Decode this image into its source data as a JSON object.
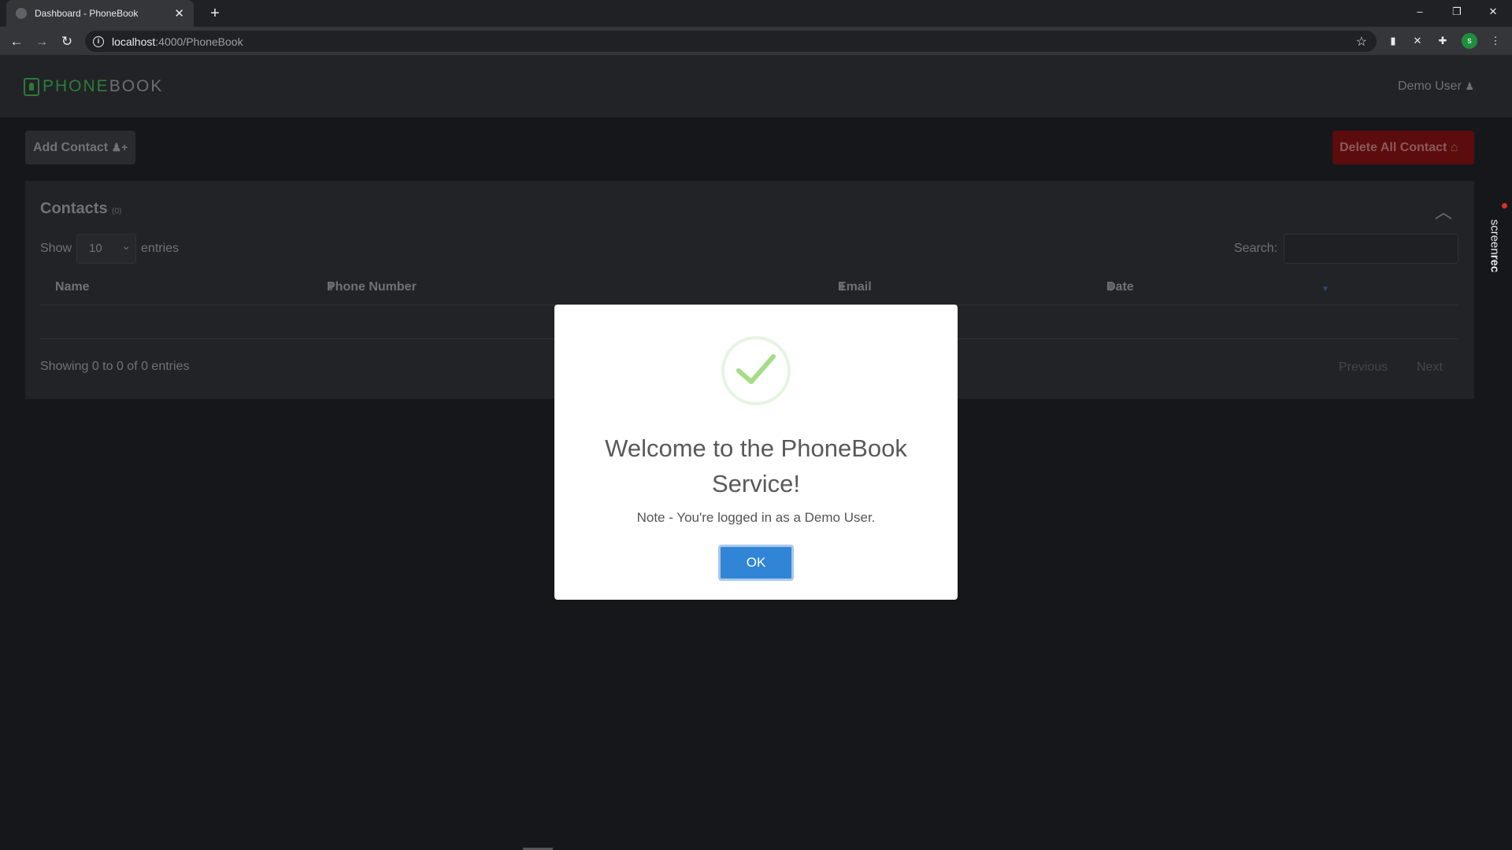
{
  "browser": {
    "tab_title": "Dashboard - PhoneBook",
    "tab_close": "✕",
    "new_tab": "+",
    "url_host": "localhost",
    "url_path": ":4000/PhoneBook",
    "profile_initial": "s",
    "window": {
      "minimize": "–",
      "restore": "❐",
      "close": "✕"
    }
  },
  "app": {
    "logo_part1": "PHONE",
    "logo_part2": "BOOK",
    "user_label": "Demo User",
    "user_icon": "user-icon",
    "add_button": "Add Contact",
    "delete_button": "Delete All Contact"
  },
  "contacts": {
    "title": "Contacts",
    "count": "(0)",
    "show_label": "Show",
    "entries_value": "10",
    "entries_label": "entries",
    "search_label": "Search:",
    "search_value": "",
    "columns": [
      "Name",
      "Phone Number",
      "Email",
      "Date"
    ],
    "info": "Showing 0 to 0 of 0 entries",
    "previous": "Previous",
    "next": "Next"
  },
  "modal": {
    "title": "Welcome to the PhoneBook Service!",
    "text": "Note - You're logged in as a Demo User.",
    "ok": "OK",
    "icon": "success-check-icon"
  },
  "overlay_brand": {
    "part1": "screen",
    "part2": "rec"
  },
  "colors": {
    "success": "#a5dc86",
    "ok_button": "#3085d6",
    "delete_button": "#5c0c0c",
    "logo_green": "#2c7d3c"
  }
}
